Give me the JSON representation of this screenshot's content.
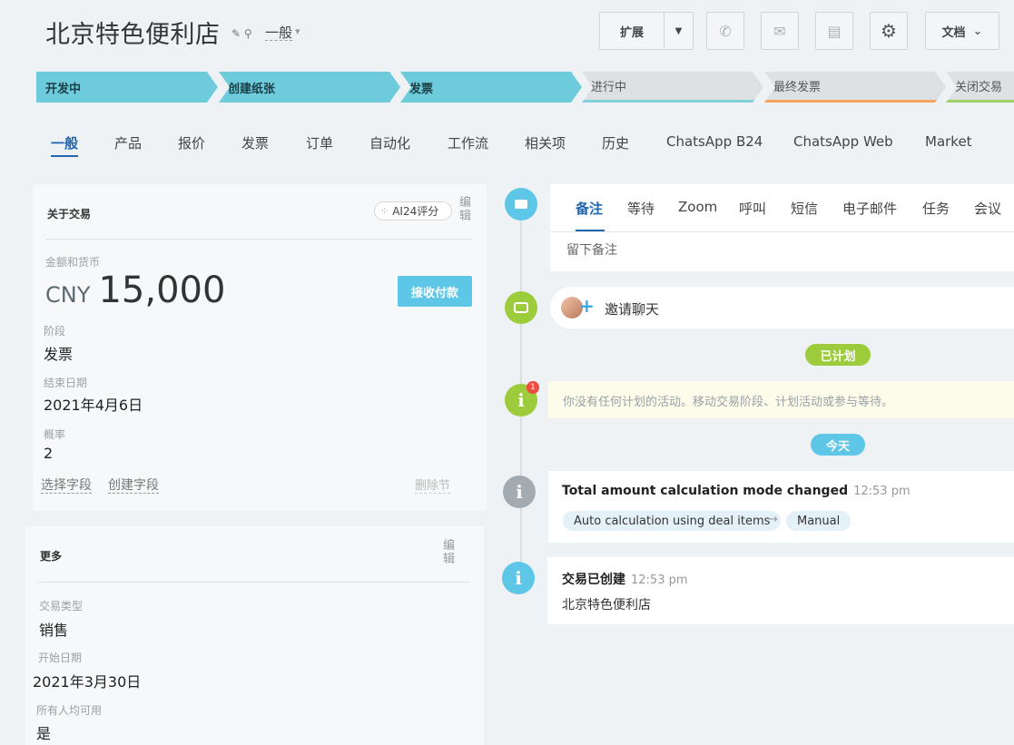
{
  "header": {
    "title": "北京特色便利店",
    "category": "一般",
    "expand_label": "扩展",
    "docs_label": "文档",
    "icons": [
      "pencil-icon",
      "link-icon",
      "phone-icon",
      "mail-icon",
      "chat-icon",
      "gear-icon"
    ]
  },
  "stages": [
    {
      "label": "开发中",
      "state": "done",
      "color": "#6dcbdb"
    },
    {
      "label": "创建纸张",
      "state": "done",
      "color": "#6dcbdb"
    },
    {
      "label": "发票",
      "state": "current",
      "color": "#6dcbdb"
    },
    {
      "label": "进行中",
      "state": "todo",
      "accent": "#7fd0d9"
    },
    {
      "label": "最终发票",
      "state": "todo",
      "accent": "#f5a25d"
    },
    {
      "label": "关闭交易",
      "state": "todo",
      "accent": "#9ed267"
    }
  ],
  "tabs": [
    "一般",
    "产品",
    "报价",
    "发票",
    "订单",
    "自动化",
    "工作流",
    "相关项",
    "历史",
    "ChatsApp B24",
    "ChatsApp Web",
    "Market"
  ],
  "active_tab": "一般",
  "about": {
    "head": "关于交易",
    "ai_label": "AI24评分",
    "edit": "编辑",
    "amount_label": "金额和货币",
    "currency": "CNY",
    "amount": "15,000",
    "pay_button": "接收付款",
    "stage_label": "阶段",
    "stage_value": "发票",
    "close_label": "结束日期",
    "close_value": "2021年4月6日",
    "prob_label": "概率",
    "prob_value": "2",
    "select_field": "选择字段",
    "create_field": "创建字段",
    "delete_section": "删除节"
  },
  "more": {
    "head": "更多",
    "edit": "编辑",
    "type_label": "交易类型",
    "type_value": "销售",
    "start_label": "开始日期",
    "start_value": "2021年3月30日",
    "public_label": "所有人均可用",
    "public_value": "是"
  },
  "compose": {
    "tabs": [
      "备注",
      "等待",
      "Zoom",
      "呼叫",
      "短信",
      "电子邮件",
      "任务",
      "会议"
    ],
    "placeholder": "留下备注"
  },
  "invite": {
    "label": "邀请聊天"
  },
  "timeline": {
    "planned": "已计划",
    "today": "今天",
    "badge": "1",
    "note": "你没有任何计划的活动。移动交易阶段、计划活动或参与等待。",
    "event1": {
      "title": "Total amount calculation mode changed",
      "time": "12:53 pm",
      "from": "Auto calculation using deal items",
      "to": "Manual"
    },
    "event2": {
      "title": "交易已创建",
      "time": "12:53 pm",
      "sub": "北京特色便利店"
    }
  }
}
